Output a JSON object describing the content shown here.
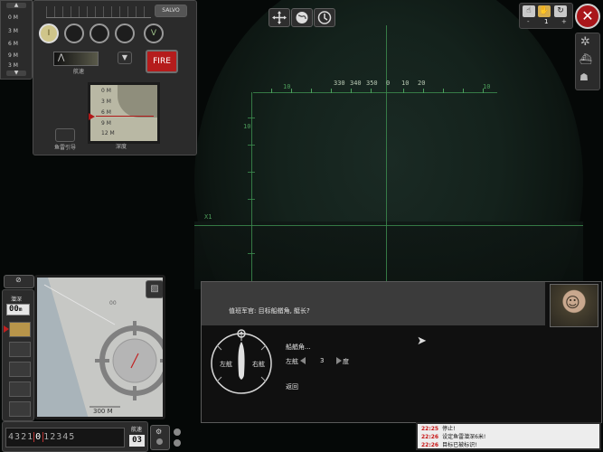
{
  "scope": {
    "scale_labels": [
      "10",
      "330",
      "340",
      "350",
      "0",
      "10",
      "20",
      "10"
    ],
    "left_marks": [
      "10",
      "X1"
    ]
  },
  "tdc": {
    "salvo_label": "SALVO",
    "fire_label": "FIRE",
    "speed_label": "航速",
    "depth_label": "深度",
    "torpedo_guide_label": "鱼雷引导",
    "torpedo_dial_letters": [
      "I",
      "",
      "",
      "",
      "V"
    ],
    "depth_marks": [
      "0 M",
      "3 M",
      "6 M",
      "9 M",
      "12 M"
    ],
    "left_gauge": [
      "0 M",
      "3 M",
      "6 M",
      "9 M",
      "3 M"
    ]
  },
  "top_center": {
    "icons": [
      "crosshair-icon",
      "globe-icon",
      "clock-icon"
    ]
  },
  "top_right": {
    "time_compression": "1",
    "minus": "-",
    "plus": "+"
  },
  "map": {
    "scale_label": "300 M",
    "marker": "00"
  },
  "depth_panel": {
    "title": "潜深",
    "value": "00",
    "unit": "m"
  },
  "speed_bar": {
    "reverse": [
      "4",
      "3",
      "2",
      "1"
    ],
    "current": "0",
    "forward": [
      "1",
      "2",
      "3",
      "4",
      "5"
    ],
    "sub_label": "航速",
    "speed_value": "03"
  },
  "dialog": {
    "speaker_line": "值班军官: 目标船艏角, 艇长?",
    "prompt": "船艏角...",
    "left_label": "左舷",
    "right_label": "右舷",
    "left_opt": "左舷",
    "value": "3",
    "unit": "度",
    "back": "返回"
  },
  "log": [
    {
      "time": "22:25",
      "msg": "停止!"
    },
    {
      "time": "22:26",
      "msg": "设定鱼雷潜深6米!"
    },
    {
      "time": "22:26",
      "msg": "目标已被标识!"
    }
  ],
  "colors": {
    "fire": "#b51c1c",
    "grid": "#3c8a4e",
    "log_time": "#c81818"
  }
}
